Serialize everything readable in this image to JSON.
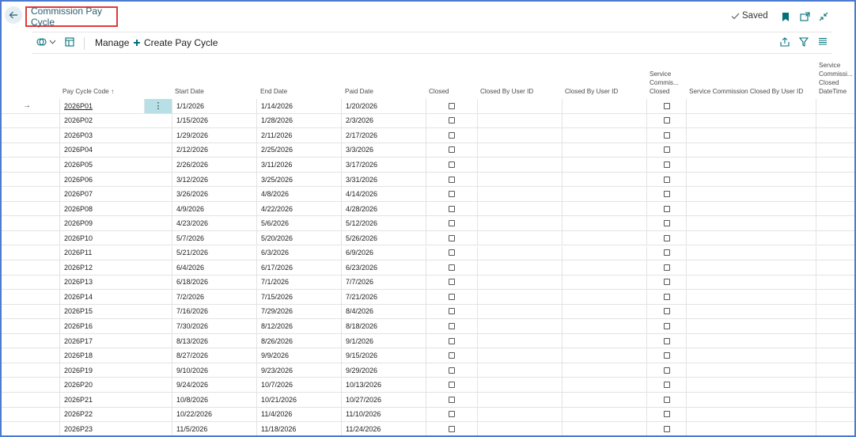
{
  "header": {
    "title": "Commission Pay Cycle",
    "saved_label": "Saved"
  },
  "actionbar": {
    "manage_label": "Manage",
    "create_label": "Create Pay Cycle"
  },
  "columns": {
    "pay_cycle_code": "Pay Cycle Code",
    "sort_indicator": "↑",
    "start_date": "Start Date",
    "end_date": "End Date",
    "paid_date": "Paid Date",
    "closed": "Closed",
    "closed_by_user_id_1": "Closed By User ID",
    "closed_by_user_id_2": "Closed By User ID",
    "service_commission_closed_l1": "Service",
    "service_commission_closed_l2": "Commis...",
    "service_commission_closed_l3": "Closed",
    "service_commission_closed_by_user": "Service Commission Closed By User ID",
    "service_commission_closed_dt_l1": "Service",
    "service_commission_closed_dt_l2": "Commissi...",
    "service_commission_closed_dt_l3": "Closed",
    "service_commission_closed_dt_l4": "DateTime"
  },
  "rows": [
    {
      "code": "2026P01",
      "start": "1/1/2026",
      "end": "1/14/2026",
      "paid": "1/20/2026"
    },
    {
      "code": "2026P02",
      "start": "1/15/2026",
      "end": "1/28/2026",
      "paid": "2/3/2026"
    },
    {
      "code": "2026P03",
      "start": "1/29/2026",
      "end": "2/11/2026",
      "paid": "2/17/2026"
    },
    {
      "code": "2026P04",
      "start": "2/12/2026",
      "end": "2/25/2026",
      "paid": "3/3/2026"
    },
    {
      "code": "2026P05",
      "start": "2/26/2026",
      "end": "3/11/2026",
      "paid": "3/17/2026"
    },
    {
      "code": "2026P06",
      "start": "3/12/2026",
      "end": "3/25/2026",
      "paid": "3/31/2026"
    },
    {
      "code": "2026P07",
      "start": "3/26/2026",
      "end": "4/8/2026",
      "paid": "4/14/2026"
    },
    {
      "code": "2026P08",
      "start": "4/9/2026",
      "end": "4/22/2026",
      "paid": "4/28/2026"
    },
    {
      "code": "2026P09",
      "start": "4/23/2026",
      "end": "5/6/2026",
      "paid": "5/12/2026"
    },
    {
      "code": "2026P10",
      "start": "5/7/2026",
      "end": "5/20/2026",
      "paid": "5/26/2026"
    },
    {
      "code": "2026P11",
      "start": "5/21/2026",
      "end": "6/3/2026",
      "paid": "6/9/2026"
    },
    {
      "code": "2026P12",
      "start": "6/4/2026",
      "end": "6/17/2026",
      "paid": "6/23/2026"
    },
    {
      "code": "2026P13",
      "start": "6/18/2026",
      "end": "7/1/2026",
      "paid": "7/7/2026"
    },
    {
      "code": "2026P14",
      "start": "7/2/2026",
      "end": "7/15/2026",
      "paid": "7/21/2026"
    },
    {
      "code": "2026P15",
      "start": "7/16/2026",
      "end": "7/29/2026",
      "paid": "8/4/2026"
    },
    {
      "code": "2026P16",
      "start": "7/30/2026",
      "end": "8/12/2026",
      "paid": "8/18/2026"
    },
    {
      "code": "2026P17",
      "start": "8/13/2026",
      "end": "8/26/2026",
      "paid": "9/1/2026"
    },
    {
      "code": "2026P18",
      "start": "8/27/2026",
      "end": "9/9/2026",
      "paid": "9/15/2026"
    },
    {
      "code": "2026P19",
      "start": "9/10/2026",
      "end": "9/23/2026",
      "paid": "9/29/2026"
    },
    {
      "code": "2026P20",
      "start": "9/24/2026",
      "end": "10/7/2026",
      "paid": "10/13/2026"
    },
    {
      "code": "2026P21",
      "start": "10/8/2026",
      "end": "10/21/2026",
      "paid": "10/27/2026"
    },
    {
      "code": "2026P22",
      "start": "10/22/2026",
      "end": "11/4/2026",
      "paid": "11/10/2026"
    },
    {
      "code": "2026P23",
      "start": "11/5/2026",
      "end": "11/18/2026",
      "paid": "11/24/2026"
    }
  ],
  "icons": {
    "back": "back-arrow-icon",
    "bookmark": "bookmark-icon",
    "open_new": "open-new-window-icon",
    "collapse": "collapse-icon",
    "share": "share-icon",
    "filter": "filter-icon",
    "list": "list-view-icon"
  },
  "colors": {
    "accent": "#00717a",
    "title": "#2b5d6e",
    "highlight": "#e03a3a",
    "selected_cell": "#b6e0e6"
  }
}
